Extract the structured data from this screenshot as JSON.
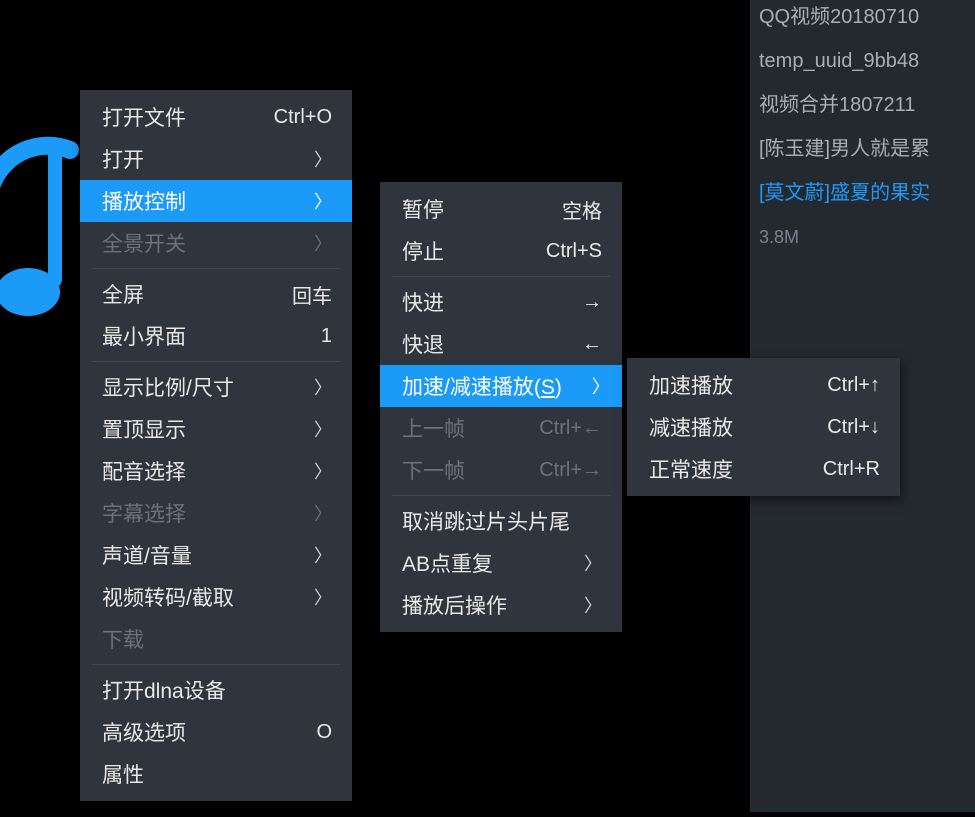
{
  "sidebar": {
    "items": [
      {
        "label": "QQ视频20180710"
      },
      {
        "label": "temp_uuid_9bb48"
      },
      {
        "label": "视频合并1807211"
      },
      {
        "label": "[陈玉建]男人就是累"
      },
      {
        "label": "[莫文蔚]盛夏的果实"
      }
    ],
    "size": "3.8M"
  },
  "menu1": {
    "items": [
      {
        "type": "item",
        "label": "打开文件",
        "shortcut": "Ctrl+O"
      },
      {
        "type": "item",
        "label": "打开",
        "submenu": true
      },
      {
        "type": "item",
        "label": "播放控制",
        "submenu": true,
        "highlight": true
      },
      {
        "type": "item",
        "label": "全景开关",
        "submenu": true,
        "disabled": true
      },
      {
        "type": "divider"
      },
      {
        "type": "item",
        "label": "全屏",
        "shortcut": "回车"
      },
      {
        "type": "item",
        "label": "最小界面",
        "shortcut": "1"
      },
      {
        "type": "divider"
      },
      {
        "type": "item",
        "label": "显示比例/尺寸",
        "submenu": true
      },
      {
        "type": "item",
        "label": "置顶显示",
        "submenu": true
      },
      {
        "type": "item",
        "label": "配音选择",
        "submenu": true
      },
      {
        "type": "item",
        "label": "字幕选择",
        "submenu": true,
        "disabled": true
      },
      {
        "type": "item",
        "label": "声道/音量",
        "submenu": true
      },
      {
        "type": "item",
        "label": "视频转码/截取",
        "submenu": true
      },
      {
        "type": "item",
        "label": "下载",
        "disabled": true
      },
      {
        "type": "divider"
      },
      {
        "type": "item",
        "label": "打开dlna设备"
      },
      {
        "type": "item",
        "label": "高级选项",
        "shortcut": "O"
      },
      {
        "type": "item",
        "label": "属性"
      }
    ]
  },
  "menu2": {
    "items": [
      {
        "type": "item",
        "label": "暂停",
        "shortcut": "空格"
      },
      {
        "type": "item",
        "label": "停止",
        "shortcut": "Ctrl+S"
      },
      {
        "type": "divider"
      },
      {
        "type": "item",
        "label": "快进",
        "shortcut": "→"
      },
      {
        "type": "item",
        "label": "快退",
        "shortcut": "←"
      },
      {
        "type": "item",
        "label": "加速/减速播放(",
        "label_u": "S",
        "label_tail": ")",
        "submenu": true,
        "highlight": true
      },
      {
        "type": "item",
        "label": "上一帧",
        "shortcut": "Ctrl+←",
        "disabled": true
      },
      {
        "type": "item",
        "label": "下一帧",
        "shortcut": "Ctrl+→",
        "disabled": true
      },
      {
        "type": "divider"
      },
      {
        "type": "item",
        "label": "取消跳过片头片尾"
      },
      {
        "type": "item",
        "label": "AB点重复",
        "submenu": true
      },
      {
        "type": "item",
        "label": "播放后操作",
        "submenu": true
      }
    ]
  },
  "menu3": {
    "items": [
      {
        "type": "item",
        "label": "加速播放",
        "shortcut": "Ctrl+↑"
      },
      {
        "type": "item",
        "label": "减速播放",
        "shortcut": "Ctrl+↓"
      },
      {
        "type": "item",
        "label": "正常速度",
        "shortcut": "Ctrl+R"
      }
    ]
  }
}
